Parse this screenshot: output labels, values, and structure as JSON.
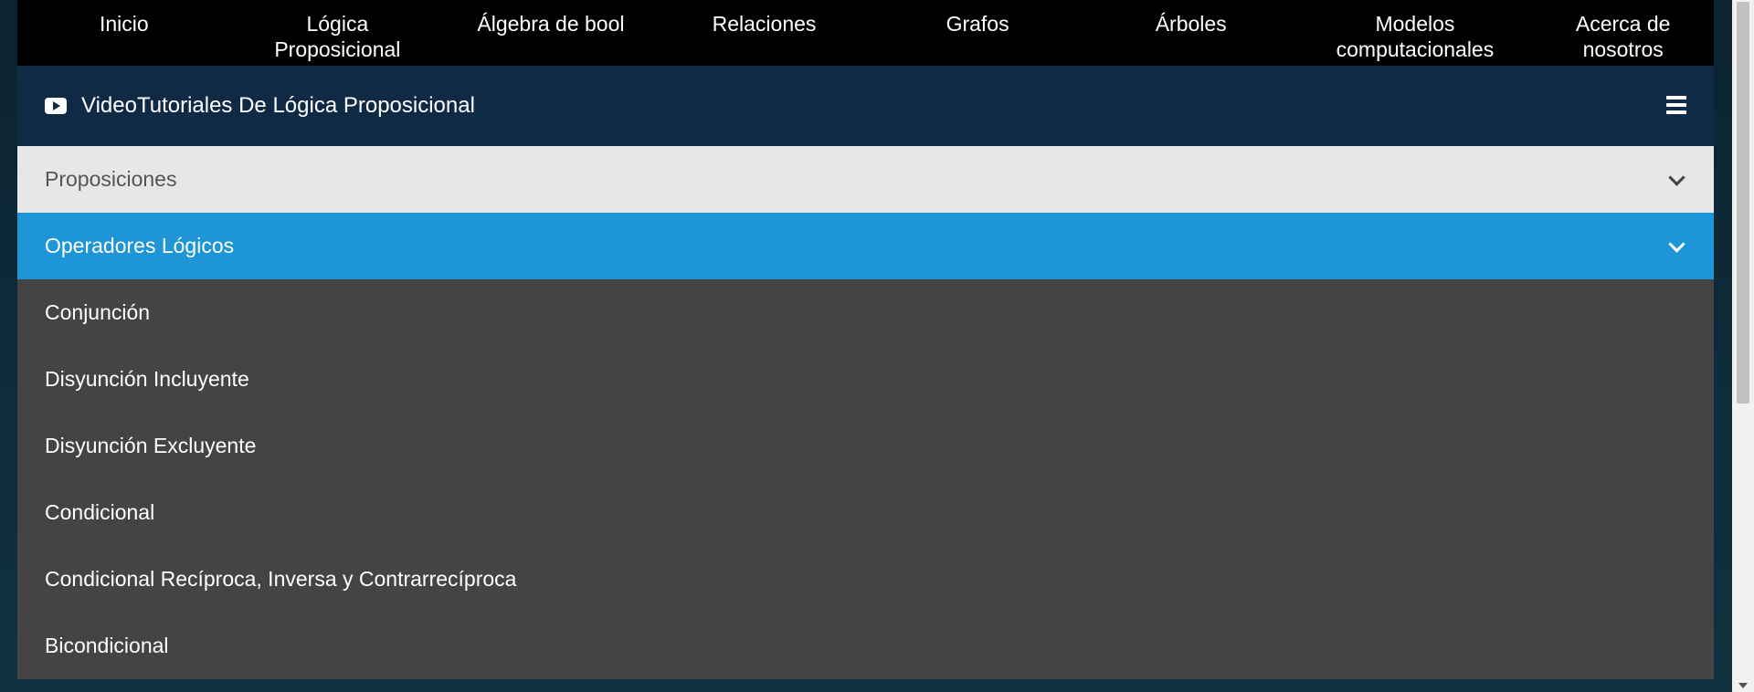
{
  "nav": {
    "items": [
      {
        "label": "Inicio"
      },
      {
        "label": "Lógica\nProposicional"
      },
      {
        "label": "Álgebra de bool"
      },
      {
        "label": "Relaciones"
      },
      {
        "label": "Grafos"
      },
      {
        "label": "Árboles"
      },
      {
        "label": "Modelos\ncomputacionales"
      },
      {
        "label": "Acerca de\nnosotros"
      }
    ]
  },
  "header": {
    "icon": "youtube-play-icon",
    "title": "VideoTutoriales De Lógica Proposicional",
    "menu_icon": "hamburger-menu-icon"
  },
  "accordion": {
    "sections": [
      {
        "label": "Proposiciones",
        "state": "collapsed"
      },
      {
        "label": "Operadores Lógicos",
        "state": "expanded"
      }
    ],
    "items": [
      {
        "label": "Conjunción"
      },
      {
        "label": "Disyunción Incluyente"
      },
      {
        "label": "Disyunción Excluyente"
      },
      {
        "label": "Condicional"
      },
      {
        "label": "Condicional Recíproca, Inversa y Contrarrecíproca"
      },
      {
        "label": "Bicondicional"
      }
    ]
  },
  "colors": {
    "nav_bg": "#000000",
    "header_bg": "#0f2a44",
    "section_light": "#e8e6e7",
    "section_active": "#1e95d6",
    "list_bg": "#444444"
  }
}
